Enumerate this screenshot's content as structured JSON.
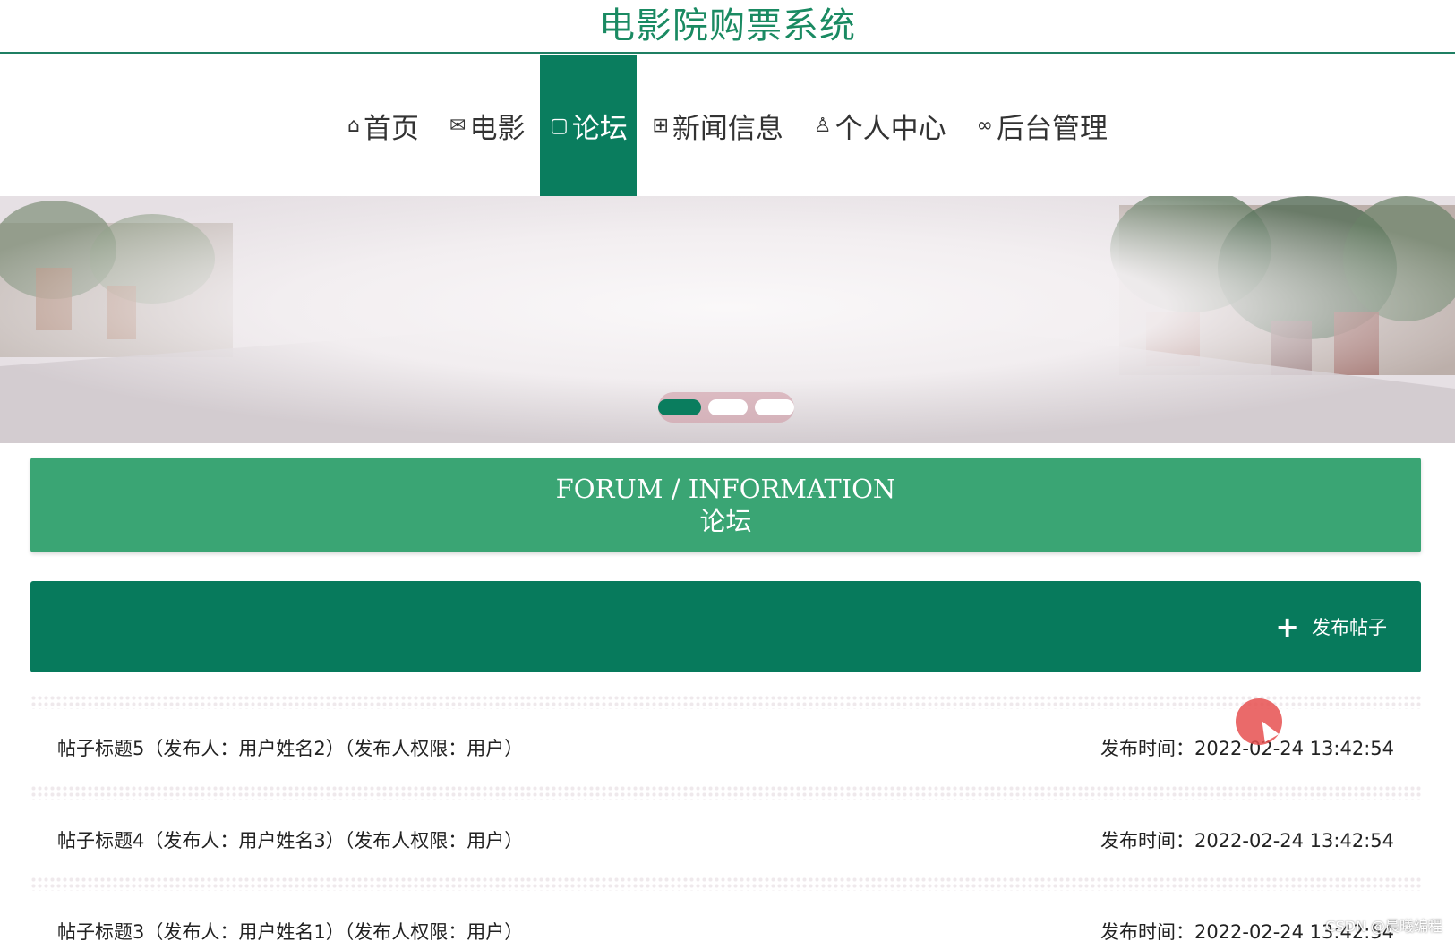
{
  "site": {
    "title": "电影院购票系统"
  },
  "nav": {
    "items": [
      {
        "icon": "home-icon",
        "glyph": "⌂",
        "label": "首页"
      },
      {
        "icon": "mail-icon",
        "glyph": "✉",
        "label": "电影"
      },
      {
        "icon": "document-icon",
        "glyph": "▢",
        "label": "论坛",
        "active": true
      },
      {
        "icon": "gift-icon",
        "glyph": "⊞",
        "label": "新闻信息"
      },
      {
        "icon": "user-icon",
        "glyph": "♙",
        "label": "个人中心"
      },
      {
        "icon": "link-icon",
        "glyph": "∞",
        "label": "后台管理"
      }
    ]
  },
  "banner": {
    "slides": 3,
    "active_slide": 1
  },
  "section": {
    "title_en": "FORUM / INFORMATION",
    "title_cn": "论坛"
  },
  "toolbar": {
    "post_icon": "plus-icon",
    "post_label": "发布帖子"
  },
  "posts": [
    {
      "title": "帖子标题5（发布人：用户姓名2）（发布人权限：用户）",
      "time": "发布时间：2022-02-24 13:42:54"
    },
    {
      "title": "帖子标题4（发布人：用户姓名3）（发布人权限：用户）",
      "time": "发布时间：2022-02-24 13:42:54"
    },
    {
      "title": "帖子标题3（发布人：用户姓名1）（发布人权限：用户）",
      "time": "发布时间：2022-02-24 13:42:54"
    }
  ],
  "watermark": "CSDN @晨曦编程",
  "colors": {
    "primary": "#0a7d5e",
    "header_band": "#3aa574",
    "title": "#1a8a62"
  }
}
